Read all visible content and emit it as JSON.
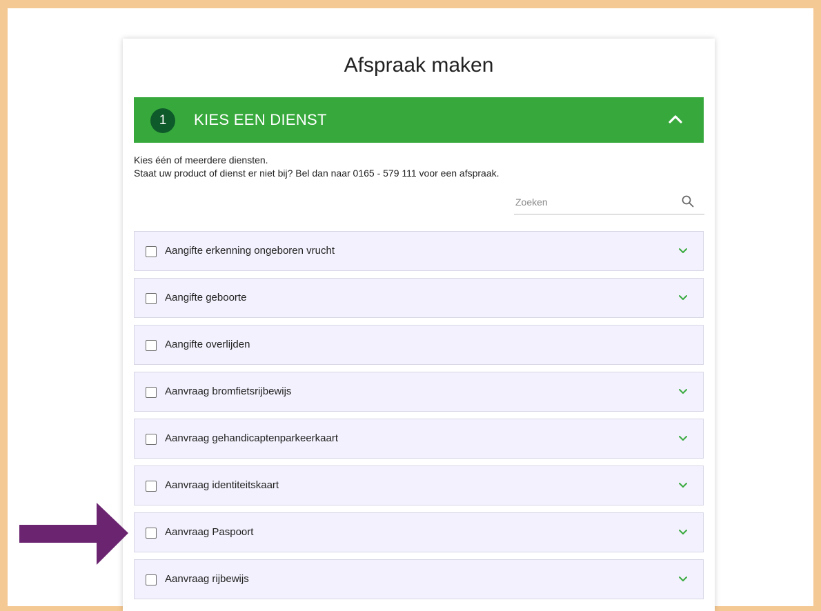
{
  "page": {
    "title": "Afspraak maken"
  },
  "step": {
    "number": "1",
    "title": "KIES EEN DIENST",
    "collapse_icon": "chevron-up-icon"
  },
  "intro": {
    "line1": "Kies één of meerdere diensten.",
    "line2": "Staat uw product of dienst er niet bij? Bel dan naar 0165 - 579 111 voor een afspraak."
  },
  "search": {
    "placeholder": "Zoeken",
    "value": "",
    "icon": "search-icon"
  },
  "services": [
    {
      "label": "Aangifte erkenning ongeboren vrucht",
      "checked": false,
      "expandable": true
    },
    {
      "label": "Aangifte geboorte",
      "checked": false,
      "expandable": true
    },
    {
      "label": "Aangifte overlijden",
      "checked": false,
      "expandable": false
    },
    {
      "label": "Aanvraag bromfietsrijbewijs",
      "checked": false,
      "expandable": true
    },
    {
      "label": "Aanvraag gehandicaptenparkeerkaart",
      "checked": false,
      "expandable": true
    },
    {
      "label": "Aanvraag identiteitskaart",
      "checked": false,
      "expandable": true
    },
    {
      "label": "Aanvraag Paspoort",
      "checked": false,
      "expandable": true
    },
    {
      "label": "Aanvraag rijbewijs",
      "checked": false,
      "expandable": true
    }
  ],
  "colors": {
    "frame": "#f5c993",
    "header_green": "#37a93c",
    "badge_green": "#0e5a2a",
    "chevron_green": "#37a93c",
    "row_bg": "#f2f1fd",
    "annotation_arrow": "#6b2470"
  },
  "annotation": {
    "icon": "arrow-right-icon",
    "points_to": "Aanvraag Paspoort"
  }
}
